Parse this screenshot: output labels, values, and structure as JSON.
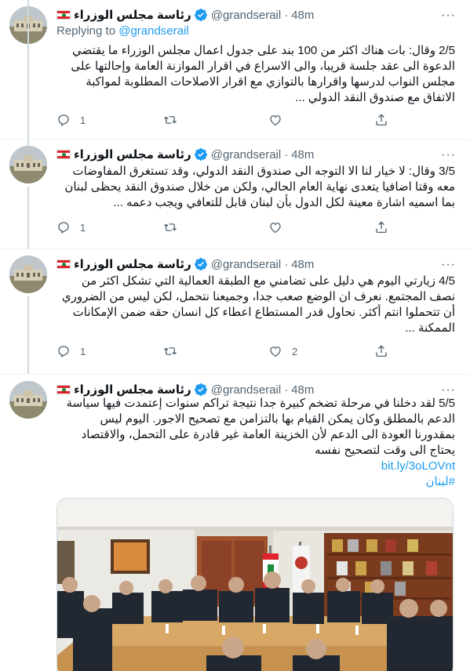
{
  "account": {
    "name": "رئاسة مجلس الوزراء",
    "handle": "@grandserail",
    "dot": "·",
    "time": "48m",
    "more": "···"
  },
  "tweets": [
    {
      "reply_prefix": "Replying to ",
      "reply_handle": "@grandserail",
      "text": "2/5 وقال: بات هناك اكثر من 100 بند على جدول اعمال مجلس الوزراء ما يقتضي الدعوة الى عقد جلسة قريبا، والى الاسراع في اقرار الموازنة العامة وإحالتها على مجلس النواب لدرسها واقرارها بالتوازي مع اقرار الاصلاحات المطلوبة لمواكبة الاتفاق مع صندوق النقد الدولي ...",
      "replies": "1",
      "retweets": "",
      "likes": ""
    },
    {
      "text": "3/5 وقال: لا خيار لنا الا التوجه الى صندوق النقد الدولي، وقد تستغرق المفاوضات معه وقتا اضافيا يتعدى نهاية العام الحالي، ولكن من خلال صندوق النقد يحظى لبنان بما اسميه اشارة معينة لكل الدول بأن لبنان قابل للتعافي ويجب دعمه ...",
      "replies": "1",
      "retweets": "",
      "likes": ""
    },
    {
      "text": "4/5 زيارتي اليوم هي دليل على تضامني مع الطبقة العمالية التي تشكل اكثر من نصف المجتمع. نعرف ان الوضع صعب جدا، وجميعنا نتحمل، لكن ليس من الضروري أن تتحملوا انتم أكثر. نحاول قدر المستطاع اعطاء كل انسان حقه ضمن الإمكانات الممكنة ...",
      "replies": "1",
      "retweets": "",
      "likes": "2"
    },
    {
      "text": "5/5 لقد دخلنا في مرحلة تضخم كبيرة جدا نتيجة تراكم سنوات إعتمدت فيها سياسة الدعم بالمطلق وكان يمكن القيام بها بالتزامن مع تصحيح الاجور. اليوم ليس بمقدورنا العودة الى الدعم لأن الخزينة العامة غير قادرة على التحمل، والاقتصاد يحتاج الى وقت لتصحيح نفسه",
      "link": "bit.ly/3oLOVnt",
      "hashtag": "#لبنان"
    }
  ],
  "colors": {
    "accent": "#1d9bf0",
    "text": "#0f1419",
    "secondary": "#536471",
    "flag_red": "#e0232b",
    "flag_green": "#1a8c3a"
  },
  "icons": [
    "lebanon-flag-icon",
    "verified-badge-icon",
    "more-icon",
    "reply-icon",
    "retweet-icon",
    "like-icon",
    "share-icon"
  ]
}
